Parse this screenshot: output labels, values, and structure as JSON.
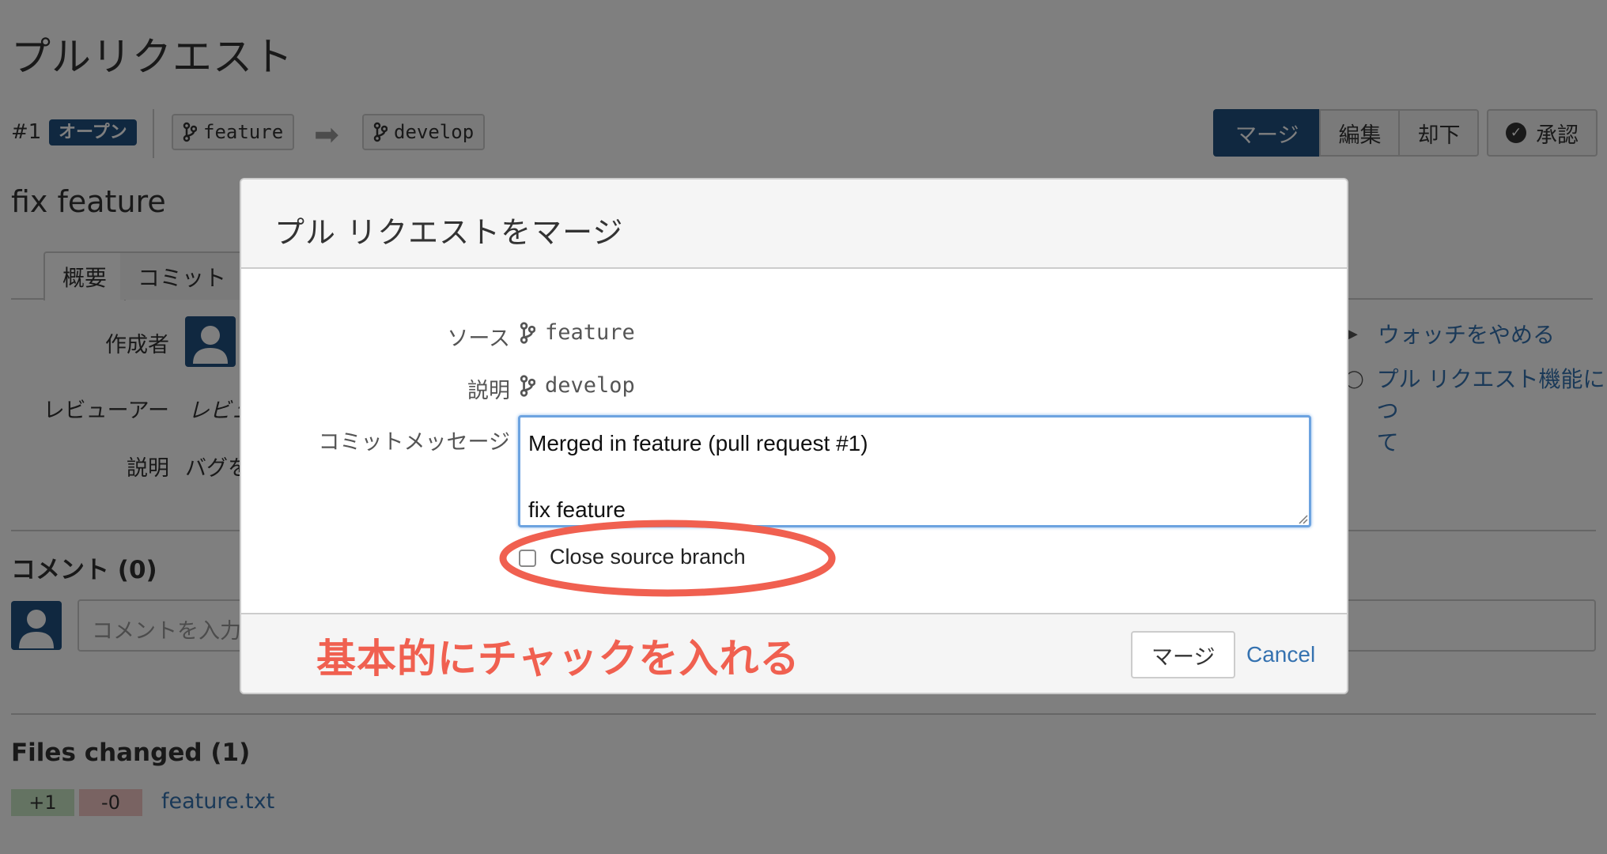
{
  "page": {
    "title": "プルリクエスト",
    "pr_number": "#1",
    "status": "オープン",
    "source_branch": "feature",
    "target_branch": "develop",
    "actions": [
      "マージ",
      "編集",
      "却下"
    ],
    "approve_label": "承認",
    "pr_title": "fix feature",
    "tabs": [
      "概要",
      "コミット"
    ],
    "author_label": "作成者",
    "reviewer_label": "レビューアー",
    "reviewer_value": "レビュ",
    "description_label": "説明",
    "description_value": "バグを",
    "comments_heading": "コメント (0)",
    "comment_placeholder": "コメントを入力",
    "files_heading": "Files changed (1)",
    "added": "+1",
    "removed": "-0",
    "file_name": "feature.txt",
    "side_watch": "ウォッチをやめる",
    "side_about": "プル リクエスト機能につ\nて"
  },
  "dialog": {
    "title": "プル リクエストをマージ",
    "source_label": "ソース",
    "source_branch": "feature",
    "destination_label": "説明",
    "destination_branch": "develop",
    "message_label": "コミットメッセージ",
    "commit_message": "Merged in feature (pull request #1)\n\nfix feature",
    "close_branch_label": "Close source branch",
    "close_branch_checked": false,
    "merge_button": "マージ",
    "cancel_link": "Cancel"
  },
  "annotation": {
    "text": "基本的にチャックを入れる",
    "color": "#f06050"
  },
  "colors": {
    "primary": "#205081",
    "link": "#3572b0"
  }
}
